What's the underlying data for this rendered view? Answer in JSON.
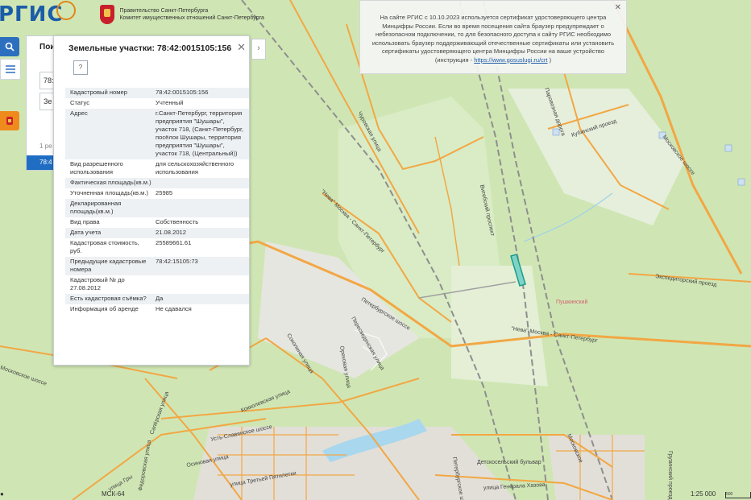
{
  "header": {
    "logo_text": "РГИС",
    "gov_line1": "Правительство Санкт-Петербурга",
    "gov_line2": "Комитет имущественных отношений Санкт-Петербурга"
  },
  "search_panel": {
    "title": "Пои",
    "input_value": "78:",
    "select_value": "Зе",
    "count_text": "1 ре",
    "result_text": "78:4"
  },
  "popup": {
    "title": "Земельные участки: 78:42:0015105:156",
    "rows": [
      {
        "label": "Кадастровый номер",
        "value": "78:42:0015105:156"
      },
      {
        "label": "Статус",
        "value": "Учтенный"
      },
      {
        "label": "Адрес",
        "value": "г.Санкт-Петербург, территория предприятия \"Шушары\", участок 718, (Санкт-Петербург, посёлок Шушары, территория предприятия \"Шушары\", участок 718, (Центральный))"
      },
      {
        "label": "Вид разрешенного использования",
        "value": "для сельскохозяйственного использования"
      },
      {
        "label": "Фактическая площадь(кв.м.)",
        "value": ""
      },
      {
        "label": "Уточненная площадь(кв.м.)",
        "value": "25985"
      },
      {
        "label": "Декларированная площадь(кв.м.)",
        "value": ""
      },
      {
        "label": "Вид права",
        "value": "Собственность"
      },
      {
        "label": "Дата учета",
        "value": "21.08.2012"
      },
      {
        "label": "Кадастровая стоимость, руб.",
        "value": "25589661.61"
      },
      {
        "label": "Предыдущие кадастровые номера",
        "value": "78:42:15105:73"
      },
      {
        "label": "Кадастровый № до 27.08.2012",
        "value": ""
      },
      {
        "label": "Есть кадастровая съёмка?",
        "value": "Да"
      },
      {
        "label": "Информация об аренде",
        "value": "Не сдавался"
      }
    ]
  },
  "notice": {
    "text": "На сайте РГИС с 10.10.2023 используется сертификат удостоверяющего центра Минцифры России. Если во время посещения сайта браузер предупреждает о небезопасном подключении, то для безопасного доступа к сайту РГИС необходимо использовать браузер поддерживающий отечественные сертификаты или установить сертификаты удостоверяющего центра Минцифры России на ваше устройство (инструкция - ",
    "link": "https://www.gosuslugi.ru/crt",
    "tail": " )"
  },
  "map_labels": [
    "Чуровская улица",
    "\"Нева\" Москва - Санкт-Петербург",
    "Витебский проспект",
    "Паровозная дорога",
    "Кубинский проезд",
    "Московское шоссе",
    "Экспедиторский проезд",
    "Пушкинский",
    "Петербургское шоссе",
    "Пересведенская улица",
    "Соколиная улица",
    "Ореховая улица",
    "Кокколевская улица",
    "Усть-Славянское шоссе",
    "Сапёрская улица",
    "Федоровская улица",
    "Детскосельский бульвар",
    "улица Генерала Хазова",
    "Осиновая улица",
    "улица Третьей Пятилетки",
    "улица Гры",
    "\"Нева\" Москва - Санкт-Петербург",
    "Московское шоссе",
    "Петербургское шоссе",
    "Московское",
    "Грузинский проезд"
  ],
  "status_bar": {
    "crs": "МСК-64",
    "scale": "1:25 000",
    "scale_bar_label": "500"
  },
  "colors": {
    "map_green": "#cfe6b4",
    "road": "#f2a744",
    "accent": "#1f6ec4",
    "parcel": "#2fb8a9"
  }
}
